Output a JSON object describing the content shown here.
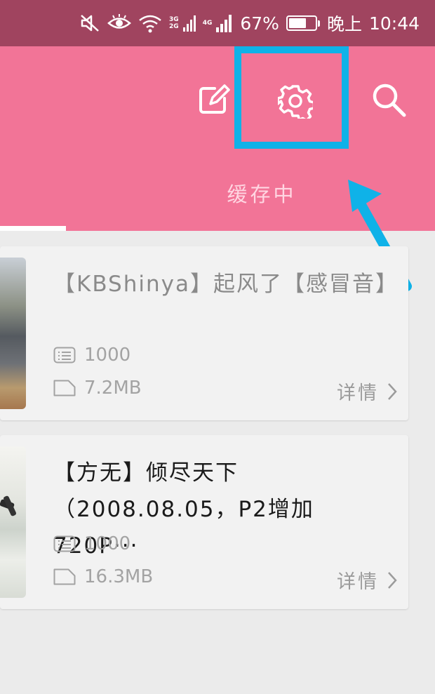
{
  "status_bar": {
    "net_top": "3G",
    "net_bottom": "2G",
    "net_4g": "4G",
    "battery_text": "67%",
    "battery_level": 0.67,
    "am_pm": "晚上",
    "time": "10:44"
  },
  "app_bar": {
    "tab_label": "缓存中",
    "icons": [
      "edit-icon",
      "settings-icon",
      "search-icon"
    ],
    "highlight_color": "#0fb2e8"
  },
  "items": [
    {
      "title": "【KBShinya】起风了【感冒音】",
      "count": "1000",
      "size": "7.2MB",
      "detail": "详情"
    },
    {
      "title": "【方无】倾尽天下（2008.08.05，P2增加720P···",
      "count": "1000",
      "size": "16.3MB",
      "detail": "详情"
    }
  ],
  "colors": {
    "status_bar": "#a0445f",
    "app_bar": "#f27497",
    "annotation": "#0fb2e8"
  }
}
